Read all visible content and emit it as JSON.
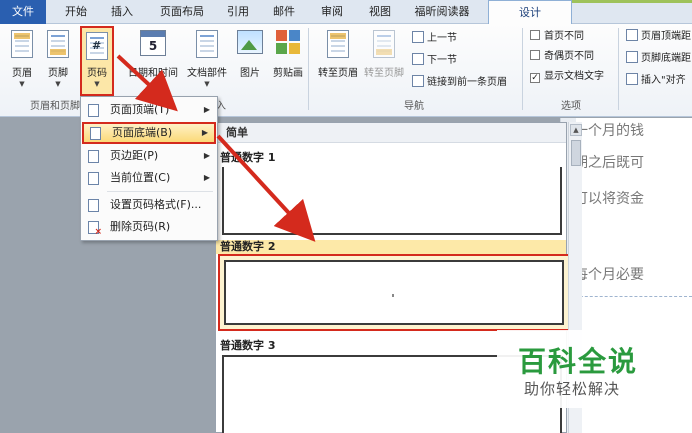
{
  "tabs": [
    {
      "label": "文件"
    },
    {
      "label": "开始"
    },
    {
      "label": "插入"
    },
    {
      "label": "页面布局"
    },
    {
      "label": "引用"
    },
    {
      "label": "邮件"
    },
    {
      "label": "审阅"
    },
    {
      "label": "视图"
    },
    {
      "label": "福昕阅读器"
    },
    {
      "label": "设计"
    }
  ],
  "ribbon": {
    "header": "页眉",
    "footer": "页脚",
    "page_number": "页码",
    "date_time": "日期和时间",
    "doc_parts": "文档部件",
    "picture": "图片",
    "clipart": "剪贴画",
    "goto_header": "转至页眉",
    "goto_footer": "转至页脚",
    "prev_section": "上一节",
    "next_section": "下一节",
    "link_prev": "链接到前一条页眉",
    "group_header_footer": "页眉和页脚",
    "group_insert_tail": "入",
    "group_nav": "导航",
    "diff_first": "首页不同",
    "diff_odd_even": "奇偶页不同",
    "show_doc_text": "显示文档文字",
    "group_options": "选项",
    "header_top": "页眉顶端距",
    "footer_bottom": "页脚底端距",
    "insert_align": "插入\"对齐"
  },
  "menu": {
    "items": [
      {
        "label": "页面顶端(T)"
      },
      {
        "label": "页面底端(B)"
      },
      {
        "label": "页边距(P)"
      },
      {
        "label": "当前位置(C)"
      },
      {
        "label": "设置页码格式(F)..."
      },
      {
        "label": "删除页码(R)"
      }
    ]
  },
  "gallery": {
    "header": "简单",
    "items": [
      {
        "label": "普通数字 1"
      },
      {
        "label": "普通数字 2"
      },
      {
        "label": "普通数字 3"
      }
    ]
  },
  "doc": {
    "lines": [
      "如一个月的钱",
      "定期之后既可",
      "还可以将资金",
      "出每个月必要"
    ]
  },
  "watermark": {
    "logo": "百科全说",
    "sub": "助你轻松解决"
  },
  "colors": {
    "accent_red": "#d42a1d",
    "file_tab": "#2a5fb0",
    "watermark_green": "#2a9a3e"
  }
}
